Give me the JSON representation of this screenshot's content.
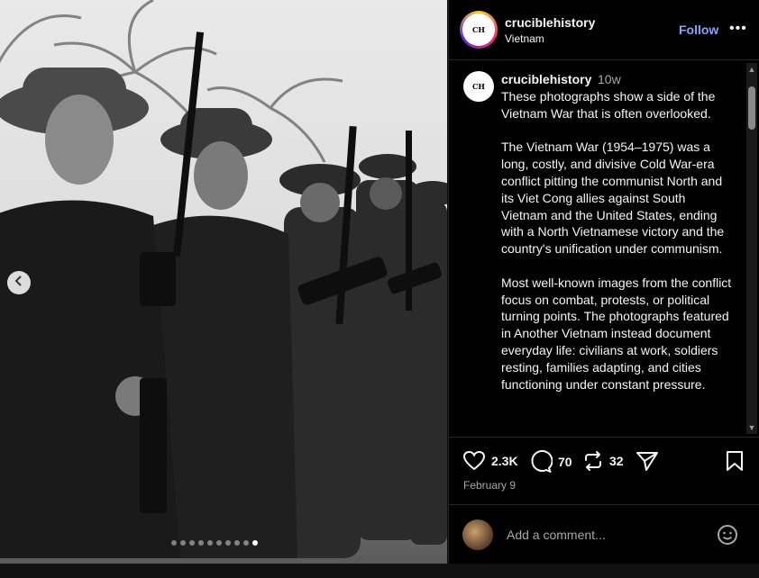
{
  "post": {
    "username": "cruciblehistory",
    "location": "Vietnam",
    "follow_label": "Follow",
    "more_label": "•••",
    "avatar_text": "CH"
  },
  "caption": {
    "username": "cruciblehistory",
    "time": "10w",
    "text": "These photographs show a side of the Vietnam War that is often overlooked.\n\nThe Vietnam War (1954–1975) was a long, costly, and divisive Cold War-era conflict pitting the communist North and its Viet Cong allies against South Vietnam and the United States, ending with a North Vietnamese victory and the country's unification under communism.\n\nMost well-known images from the conflict focus on combat, protests, or political turning points. The photographs featured in Another Vietnam instead document everyday life: civilians at work, soldiers resting, families adapting, and cities functioning under constant pressure."
  },
  "actions": {
    "likes": "2.3K",
    "comments": "70",
    "reposts": "32",
    "date": "February 9"
  },
  "comment_box": {
    "placeholder": "Add a comment..."
  },
  "carousel": {
    "slide_count": 10,
    "active_index": 9
  },
  "icons": {
    "like": "heart-icon",
    "comment": "comment-bubble-icon",
    "repost": "repost-icon",
    "share": "send-icon",
    "save": "bookmark-icon",
    "emoji": "smiley-icon",
    "prev": "chevron-left-icon"
  },
  "colors": {
    "follow": "#8ea0ff",
    "background": "#000000",
    "muted_text": "#a8a8a8"
  }
}
